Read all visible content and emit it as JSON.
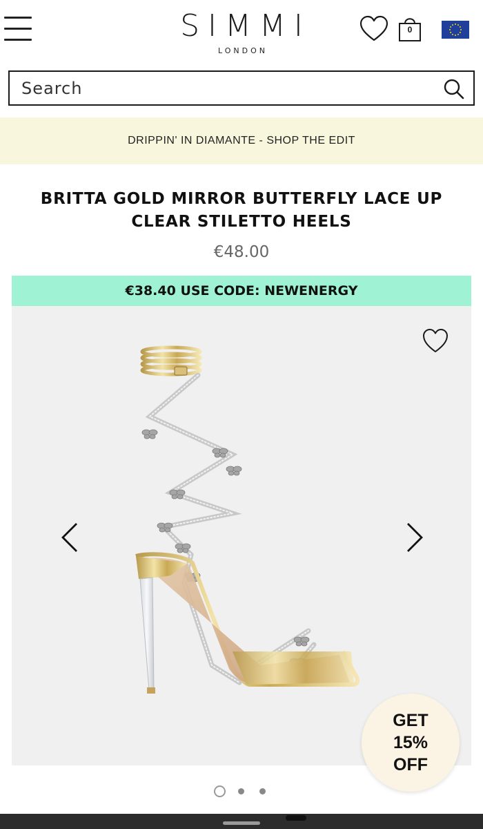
{
  "header": {
    "brand": "SIMMI",
    "brand_sub": "LONDON",
    "menu_icon": "hamburger-menu-icon",
    "wishlist_icon": "heart-icon",
    "bag_icon": "shopping-bag-icon",
    "bag_count": "0",
    "region_icon": "eu-flag-icon"
  },
  "search": {
    "placeholder": "Search",
    "value": "",
    "icon": "search-icon"
  },
  "promo_banner": {
    "text": "DRIPPIN' IN DIAMANTE - SHOP THE EDIT"
  },
  "product": {
    "title_line1": "BRITTA GOLD MIRROR BUTTERFLY LACE UP",
    "title_line2": "CLEAR STILETTO HEELS",
    "price": "€48.00",
    "discount_text": "€38.40 USE CODE: NEWENERGY"
  },
  "gallery": {
    "total_images": 3,
    "active_index": 1,
    "wishlist_icon": "heart-icon",
    "prev_icon": "chevron-left-icon",
    "next_icon": "chevron-right-icon"
  },
  "offer_badge": {
    "line1": "GET",
    "line2": "15%",
    "line3": "OFF"
  },
  "colors": {
    "promo_bg": "#f8f6dc",
    "discount_bg": "#9ff2d3",
    "gallery_bg": "#f0f0f0",
    "offer_bg": "#fbf3e4",
    "eu_flag_blue": "#1f3f9a",
    "eu_flag_star": "#ffd700"
  }
}
